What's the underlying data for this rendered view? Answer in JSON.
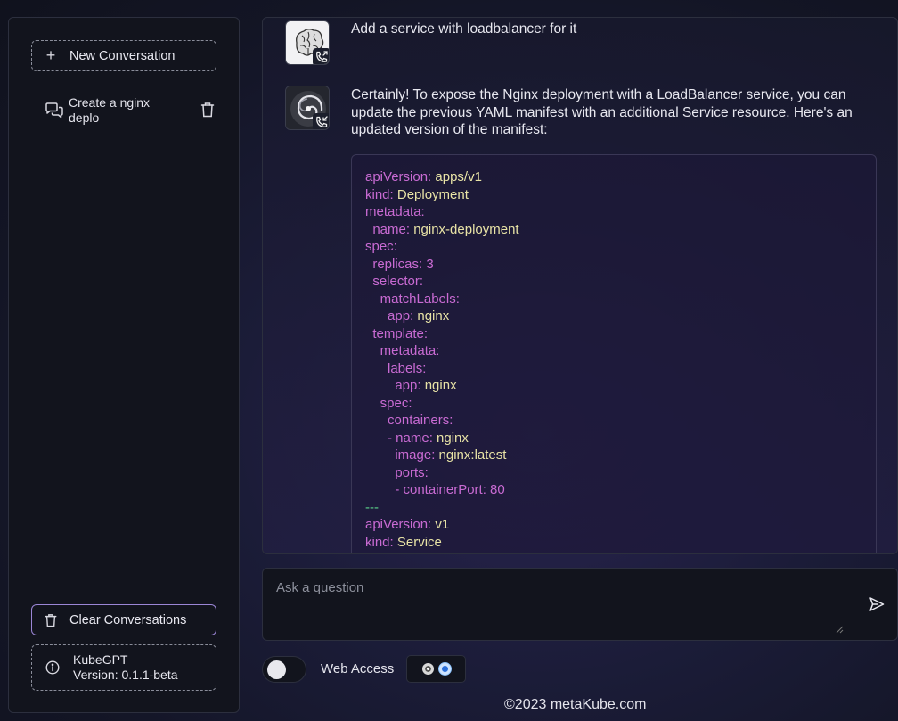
{
  "sidebar": {
    "new_conversation": "New Conversation",
    "conversations": [
      {
        "label": "Create a nginx deplo"
      }
    ],
    "clear_conversations": "Clear Conversations",
    "app_name": "KubeGPT",
    "version": "Version: 0.1.1-beta"
  },
  "chat": {
    "messages": [
      {
        "role": "user",
        "avatar_icon": "brain-icon",
        "text": "Add a service with loadbalancer for it"
      },
      {
        "role": "assistant",
        "avatar_icon": "spiral-icon",
        "text": "Certainly! To expose the Nginx deployment with a LoadBalancer service, you can update the previous YAML manifest with an additional Service resource. Here's an updated version of the manifest:"
      }
    ],
    "code": {
      "l1k": "apiVersion:",
      "l1v": " apps/v1",
      "l2k": "kind:",
      "l2v": " Deployment",
      "l3k": "metadata:",
      "l4k": "  name:",
      "l4v": " nginx-deployment",
      "l5k": "spec:",
      "l6k": "  replicas: 3",
      "l7k": "  selector:",
      "l8k": "    matchLabels:",
      "l9k": "      app:",
      "l9v": " nginx",
      "l10k": "  template:",
      "l11k": "    metadata:",
      "l12k": "      labels:",
      "l13k": "        app:",
      "l13v": " nginx",
      "l14k": "    spec:",
      "l15k": "      containers:",
      "l16k": "      - name:",
      "l16v": " nginx",
      "l17k": "        image:",
      "l17v": " nginx:latest",
      "l18k": "        ports:",
      "l19k": "        - containerPort: 80",
      "l20s": "---",
      "l21k": "apiVersion:",
      "l21v": " v1",
      "l22k": "kind:",
      "l22v": " Service"
    }
  },
  "input": {
    "placeholder": "Ask a question"
  },
  "controls": {
    "web_access_label": "Web Access",
    "web_access_enabled": false
  },
  "footer": {
    "text": "©2023 metaKube.com"
  }
}
